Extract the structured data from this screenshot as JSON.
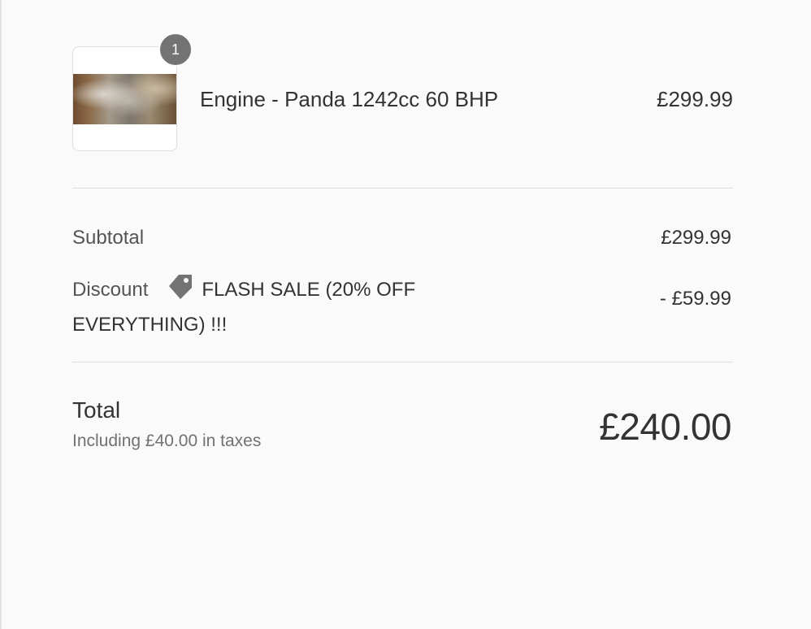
{
  "cart": {
    "items": [
      {
        "quantity": "1",
        "name": "Engine - Panda 1242cc 60 BHP",
        "price": "£299.99",
        "image_alt": "engine-thumbnail"
      }
    ]
  },
  "summary": {
    "subtotal_label": "Subtotal",
    "subtotal_value": "£299.99",
    "discount_label": "Discount",
    "discount_code": "FLASH SALE (20% OFF EVERYTHING) !!!",
    "discount_value": "- £59.99",
    "discount_icon": "tag-icon",
    "total_label": "Total",
    "tax_note": "Including £40.00 in taxes",
    "total_value": "£240.00"
  },
  "colors": {
    "background": "#fafafa",
    "text": "#333333",
    "muted": "#717171",
    "badge": "#737373",
    "divider": "#dedede"
  }
}
